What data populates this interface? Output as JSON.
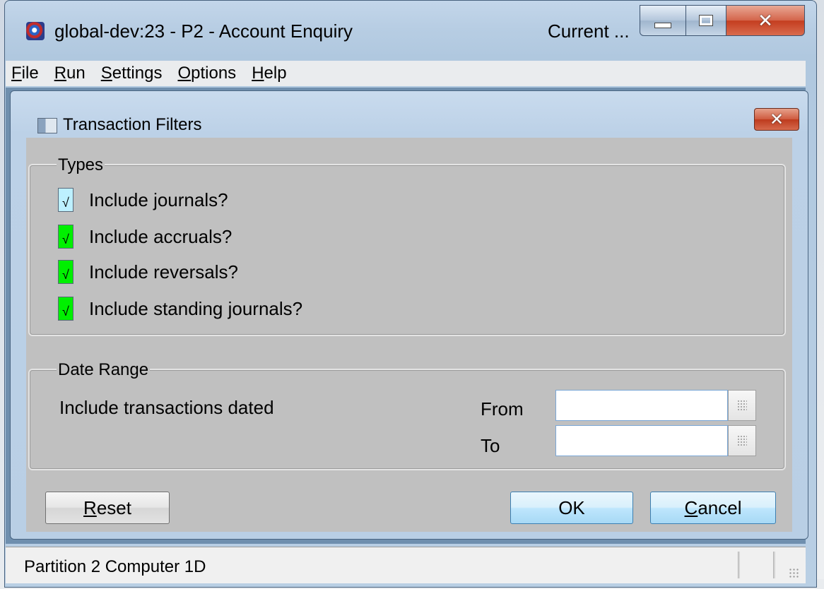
{
  "window": {
    "title": "global-dev:23 - P2 - Account Enquiry",
    "current_label": "Current ..."
  },
  "menu": {
    "items": [
      {
        "accel": "F",
        "rest": "ile"
      },
      {
        "accel": "R",
        "rest": "un"
      },
      {
        "accel": "S",
        "rest": "ettings"
      },
      {
        "accel": "O",
        "rest": "ptions"
      },
      {
        "accel": "H",
        "rest": "elp"
      }
    ]
  },
  "dialog": {
    "title": "Transaction Filters",
    "types_group": {
      "legend": "Types",
      "checkboxes": [
        {
          "label": "Include journals?",
          "checked": true,
          "mark": "√"
        },
        {
          "label": "Include accruals?",
          "checked": true,
          "mark": "√"
        },
        {
          "label": "Include reversals?",
          "checked": true,
          "mark": "√"
        },
        {
          "label": "Include standing journals?",
          "checked": true,
          "mark": "√"
        }
      ]
    },
    "date_group": {
      "legend": "Date Range",
      "prompt": "Include transactions dated",
      "from_label": "From",
      "from_value": "",
      "to_label": "To",
      "to_value": ""
    },
    "buttons": {
      "reset_accel": "R",
      "reset_rest": "eset",
      "ok": "OK",
      "cancel_accel": "C",
      "cancel_rest": "ancel"
    }
  },
  "statusbar": {
    "text": "Partition 2 Computer 1D"
  },
  "colors": {
    "checkbox_focused": "#bdf0ff",
    "checkbox_checked": "#00f000",
    "dialog_body": "#c0c0c0"
  }
}
